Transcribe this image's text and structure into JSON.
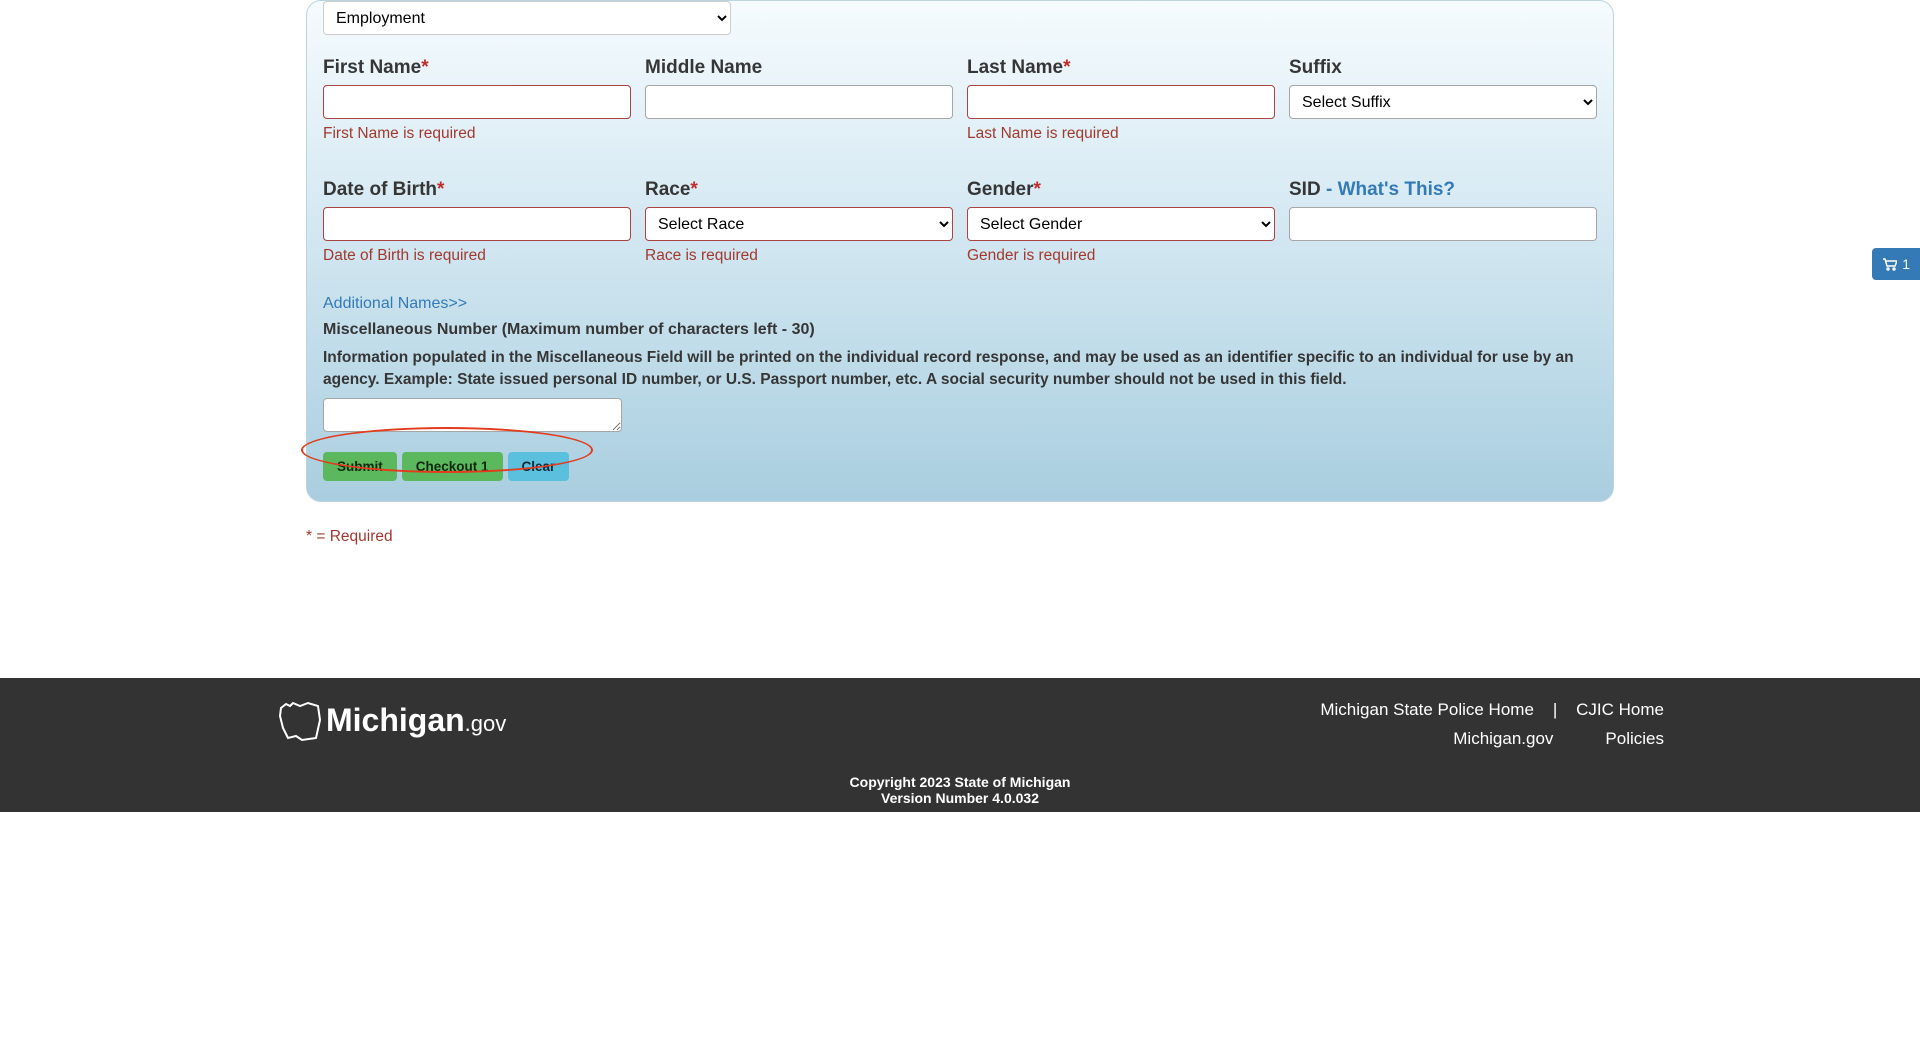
{
  "reason_select": {
    "value": "Employment"
  },
  "fields": {
    "first_name": {
      "label": "First Name",
      "error": "First Name is required"
    },
    "middle_name": {
      "label": "Middle Name"
    },
    "last_name": {
      "label": "Last Name",
      "error": "Last Name is required"
    },
    "suffix": {
      "label": "Suffix",
      "placeholder": "Select Suffix"
    },
    "dob": {
      "label": "Date of Birth",
      "error": "Date of Birth is required"
    },
    "race": {
      "label": "Race",
      "placeholder": "Select Race",
      "error": "Race is required"
    },
    "gender": {
      "label": "Gender",
      "placeholder": "Select Gender",
      "error": "Gender is required"
    },
    "sid": {
      "label": "SID",
      "whats_this": "- What's This?"
    }
  },
  "additional_names": "Additional Names>>",
  "misc": {
    "label": "Miscellaneous Number (Maximum number of characters left - 30)",
    "info": "Information populated in the Miscellaneous Field will be printed on the individual record response, and may be used as an identifier specific to an individual for use by an agency. Example: State issued personal ID number, or U.S. Passport number, etc. A social security number should not be used in this field."
  },
  "buttons": {
    "submit": "Submit",
    "checkout": "Checkout 1",
    "clear": "Clear"
  },
  "required_legend": "* = Required",
  "footer": {
    "logo": "Michigan",
    "logo_suffix": ".gov",
    "links": {
      "msp": "Michigan State Police Home",
      "sep": "|",
      "cjic": "CJIC Home",
      "mi": "Michigan.gov",
      "policies": "Policies"
    },
    "copyright": "Copyright 2023 State of Michigan",
    "version": "Version Number 4.0.032"
  },
  "cart": {
    "count": "1"
  }
}
